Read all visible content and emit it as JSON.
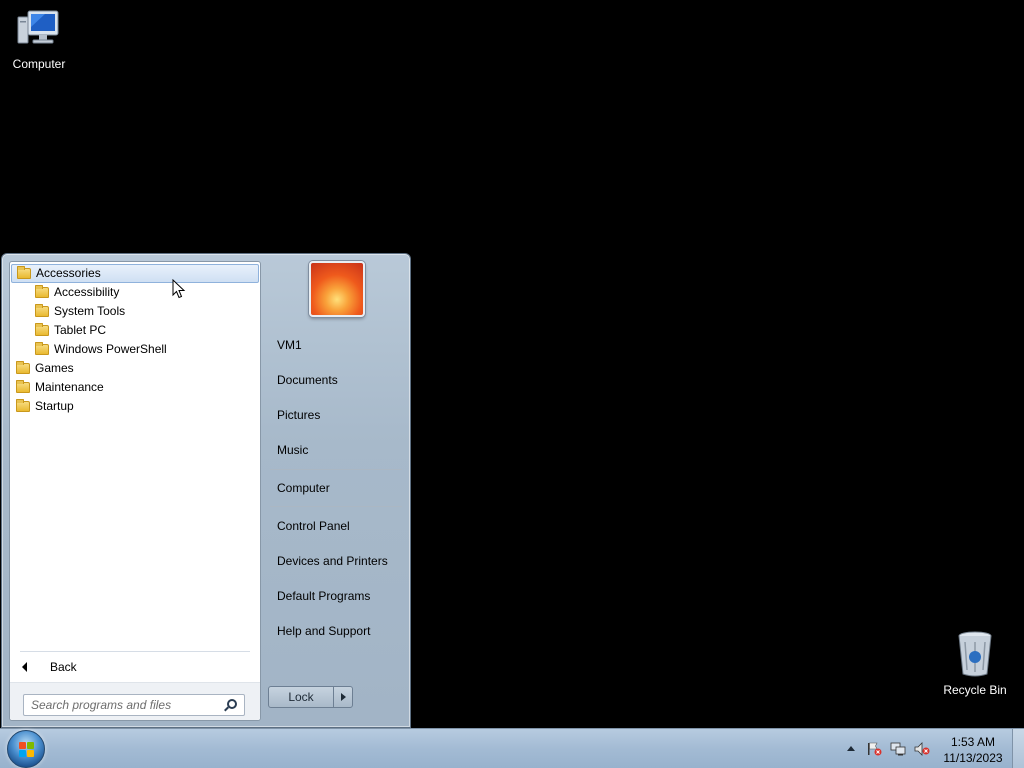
{
  "desktop": {
    "computer_label": "Computer",
    "recycle_label": "Recycle Bin"
  },
  "programs": {
    "items": [
      {
        "label": "Accessories",
        "indent": false,
        "selected": true
      },
      {
        "label": "Accessibility",
        "indent": true
      },
      {
        "label": "System Tools",
        "indent": true
      },
      {
        "label": "Tablet PC",
        "indent": true
      },
      {
        "label": "Windows PowerShell",
        "indent": true
      },
      {
        "label": "Games",
        "indent": false
      },
      {
        "label": "Maintenance",
        "indent": false
      },
      {
        "label": "Startup",
        "indent": false
      }
    ],
    "back_label": "Back"
  },
  "search": {
    "placeholder": "Search programs and files"
  },
  "right_pane": {
    "user": "VM1",
    "documents": "Documents",
    "pictures": "Pictures",
    "music": "Music",
    "computer": "Computer",
    "control_panel": "Control Panel",
    "devices": "Devices and Printers",
    "defaults": "Default Programs",
    "help": "Help and Support",
    "lock_label": "Lock"
  },
  "taskbar": {
    "time": "1:53 AM",
    "date": "11/13/2023"
  }
}
